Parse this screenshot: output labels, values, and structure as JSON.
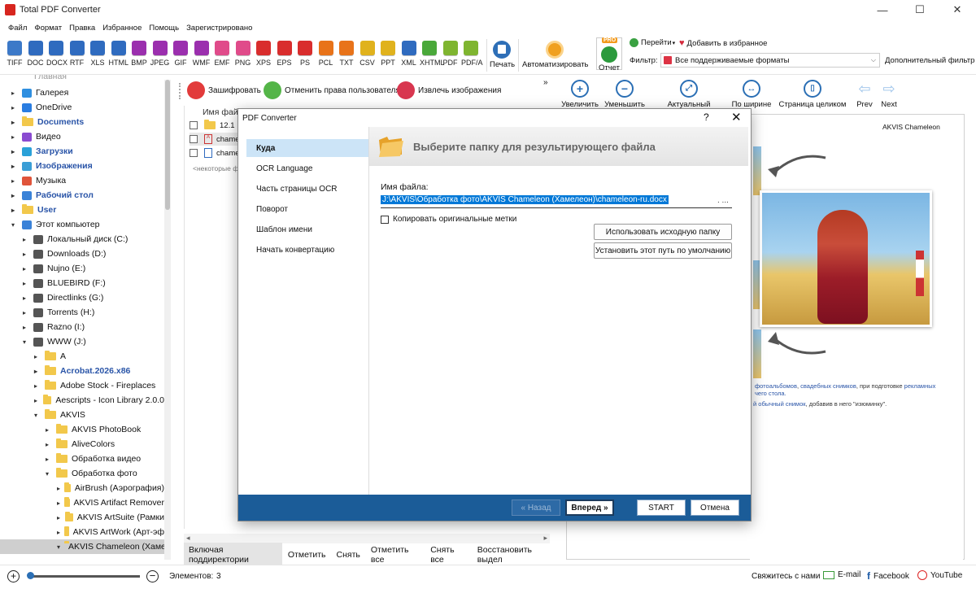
{
  "window": {
    "title": "Total PDF Converter",
    "minimize": "—",
    "maximize": "☐",
    "close": "✕"
  },
  "menu": [
    "Файл",
    "Формат",
    "Правка",
    "Избранное",
    "Помощь",
    "Зарегистрировано"
  ],
  "formats": [
    {
      "label": "TIFF",
      "color": "#3c79c8"
    },
    {
      "label": "DOC",
      "color": "#2f6bbf"
    },
    {
      "label": "DOCX",
      "color": "#2f6bbf"
    },
    {
      "label": "RTF",
      "color": "#2f6bbf"
    },
    {
      "label": "XLS",
      "color": "#2f6bbf"
    },
    {
      "label": "HTML",
      "color": "#2f6bbf"
    },
    {
      "label": "BMP",
      "color": "#9b2fae"
    },
    {
      "label": "JPEG",
      "color": "#9b2fae"
    },
    {
      "label": "GIF",
      "color": "#9b2fae"
    },
    {
      "label": "WMF",
      "color": "#9b2fae"
    },
    {
      "label": "EMF",
      "color": "#e04b8a"
    },
    {
      "label": "PNG",
      "color": "#e04b8a"
    },
    {
      "label": "XPS",
      "color": "#d92d2d"
    },
    {
      "label": "EPS",
      "color": "#d92d2d"
    },
    {
      "label": "PS",
      "color": "#d92d2d"
    },
    {
      "label": "PCL",
      "color": "#e8731a"
    },
    {
      "label": "TXT",
      "color": "#e8731a"
    },
    {
      "label": "CSV",
      "color": "#e0b21d"
    },
    {
      "label": "PPT",
      "color": "#e0b21d"
    },
    {
      "label": "XML",
      "color": "#2f6bbf"
    },
    {
      "label": "XHTML",
      "color": "#4aa83a"
    },
    {
      "label": "PDF",
      "color": "#7fb530"
    },
    {
      "label": "PDF/A",
      "color": "#7fb530"
    }
  ],
  "toolbar": {
    "print": "Печать",
    "automate": "Автоматизировать",
    "report": "Отчет",
    "pro_badge": "PRO",
    "goto": "Перейти",
    "add_fav": "Добавить в избранное",
    "filter_label": "Фильтр:",
    "filter_value": "Все поддерживаемые форматы",
    "extra_filter": "Дополнительный фильтр"
  },
  "tree": {
    "top_cut": "Главная",
    "items": [
      {
        "label": "Галерея",
        "indent": 0,
        "icon": "gallery-icon",
        "blue": false
      },
      {
        "label": "OneDrive",
        "indent": 0,
        "icon": "cloud-icon",
        "blue": false
      },
      {
        "label": "Documents",
        "indent": 0,
        "icon": "folder-icon",
        "blue": true
      },
      {
        "label": "Видео",
        "indent": 0,
        "icon": "video-icon",
        "blue": false
      },
      {
        "label": "Загрузки",
        "indent": 0,
        "icon": "download-icon",
        "blue": true
      },
      {
        "label": "Изображения",
        "indent": 0,
        "icon": "image-icon",
        "blue": true
      },
      {
        "label": "Музыка",
        "indent": 0,
        "icon": "music-icon",
        "blue": false
      },
      {
        "label": "Рабочий стол",
        "indent": 0,
        "icon": "desktop-icon",
        "blue": true
      },
      {
        "label": "User",
        "indent": 0,
        "icon": "folder-icon",
        "blue": true
      },
      {
        "label": "Этот компьютер",
        "indent": 0,
        "icon": "computer-icon",
        "blue": false
      },
      {
        "label": "Локальный диск (C:)",
        "indent": 1,
        "icon": "drive-icon",
        "blue": false
      },
      {
        "label": "Downloads (D:)",
        "indent": 1,
        "icon": "drive-icon",
        "blue": false
      },
      {
        "label": "Nujno (E:)",
        "indent": 1,
        "icon": "drive-icon",
        "blue": false
      },
      {
        "label": "BLUEBIRD (F:)",
        "indent": 1,
        "icon": "drive-icon",
        "blue": false
      },
      {
        "label": "Directlinks (G:)",
        "indent": 1,
        "icon": "drive-icon",
        "blue": false
      },
      {
        "label": "Torrents (H:)",
        "indent": 1,
        "icon": "drive-icon",
        "blue": false
      },
      {
        "label": "Razno (I:)",
        "indent": 1,
        "icon": "drive-icon",
        "blue": false
      },
      {
        "label": "WWW (J:)",
        "indent": 1,
        "icon": "drive-icon",
        "blue": false
      },
      {
        "label": "A",
        "indent": 2,
        "icon": "folder-icon",
        "blue": false
      },
      {
        "label": "Acrobat.2026.x86",
        "indent": 2,
        "icon": "folder-icon",
        "blue": true
      },
      {
        "label": "Adobe Stock - Fireplaces",
        "indent": 2,
        "icon": "folder-icon",
        "blue": false
      },
      {
        "label": "Aescripts - Icon Library 2.0.0",
        "indent": 2,
        "icon": "folder-icon",
        "blue": false
      },
      {
        "label": "AKVIS",
        "indent": 2,
        "icon": "folder-icon",
        "blue": false
      },
      {
        "label": "AKVIS PhotoBook",
        "indent": 3,
        "icon": "folder-icon",
        "blue": false
      },
      {
        "label": "AliveColors",
        "indent": 3,
        "icon": "folder-icon",
        "blue": false
      },
      {
        "label": "Обработка видео",
        "indent": 3,
        "icon": "folder-icon",
        "blue": false
      },
      {
        "label": "Обработка фото",
        "indent": 3,
        "icon": "folder-icon",
        "blue": false
      },
      {
        "label": "AirBrush (Аэрография)",
        "indent": 4,
        "icon": "folder-icon",
        "blue": false
      },
      {
        "label": "AKVIS Artifact Remover",
        "indent": 4,
        "icon": "folder-icon",
        "blue": false
      },
      {
        "label": "AKVIS ArtSuite (Рамки",
        "indent": 4,
        "icon": "folder-icon",
        "blue": false
      },
      {
        "label": "AKVIS ArtWork (Арт-эф",
        "indent": 4,
        "icon": "folder-icon",
        "blue": false
      },
      {
        "label": "AKVIS Chameleon (Хаме",
        "indent": 4,
        "icon": "folder-icon",
        "blue": false
      }
    ]
  },
  "mid": {
    "encrypt": "Зашифровать",
    "revoke": "Отменить права пользователя",
    "extract": "Извлечь изображения",
    "header": "Имя файл",
    "files": [
      "12.1",
      "chame",
      "chame"
    ],
    "placeholder": "<некоторые ф",
    "bottom": [
      "Включая поддиректории",
      "Отметить",
      "Снять",
      "Отметить все",
      "Снять все",
      "Восстановить выдел"
    ]
  },
  "preview": {
    "buttons": [
      "Увеличить",
      "Уменьшить",
      "Актуальный размер",
      "По ширине",
      "Страница целиком",
      "Prev",
      "Next"
    ],
    "brand": "AKVIS Chameleon",
    "text1a": "фотоальбомов",
    "text1b": ", ",
    "text1c": "свадебных снимков",
    "text1d": ", при подготовке ",
    "text1e": "рекламных",
    "text2": "чего стола.",
    "text3a": "й обычный снимок",
    "text3b": ", добавив в него \"изюминку\"."
  },
  "dialog": {
    "title": "PDF Converter",
    "help": "?",
    "close": "✕",
    "nav": [
      "Куда",
      "OCR Language",
      "Часть страницы OCR",
      "Поворот",
      "Шаблон имени",
      "Начать конвертацию"
    ],
    "heading": "Выберите папку для результирующего файла",
    "fname_label": "Имя файла:",
    "fname_value": "J:\\AKVIS\\Обработка фото\\AKVIS Chameleon (Хамелеон)\\chameleon-ru.docx",
    "fname_dots": ". ...",
    "copy_label": "Копировать оригинальные метки",
    "use_source": "Использовать исходную папку",
    "set_default": "Установить этот путь по умолчанию",
    "back": "« Назад",
    "next": "Вперед »",
    "start": "START",
    "cancel": "Отмена"
  },
  "status": {
    "elements_label": "Элементов:",
    "elements_count": "3",
    "contact": "Свяжитесь с нами",
    "email": "E-mail",
    "facebook": "Facebook",
    "youtube": "YouTube"
  }
}
